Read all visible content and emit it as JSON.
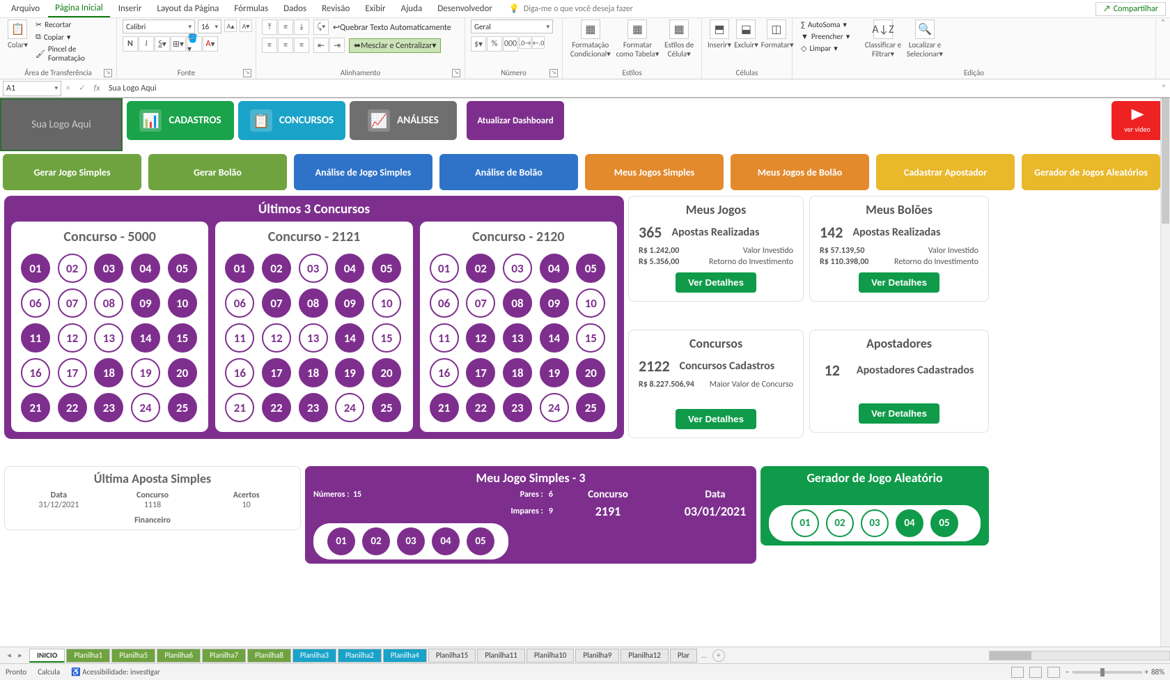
{
  "menu": {
    "items": [
      "Arquivo",
      "Página Inicial",
      "Inserir",
      "Layout da Página",
      "Fórmulas",
      "Dados",
      "Revisão",
      "Exibir",
      "Ajuda",
      "Desenvolvedor"
    ],
    "active": 1,
    "tellme": "Diga-me o que você deseja fazer",
    "share": "Compartilhar"
  },
  "ribbon": {
    "clipboard": {
      "paste": "Colar",
      "cut": "Recortar",
      "copy": "Copiar",
      "painter": "Pincel de Formatação",
      "label": "Área de Transferência"
    },
    "font": {
      "name": "Calibri",
      "size": "16",
      "label": "Fonte"
    },
    "align": {
      "wrap": "Quebrar Texto Automaticamente",
      "merge": "Mesclar e Centralizar",
      "label": "Alinhamento"
    },
    "number": {
      "format": "Geral",
      "label": "Número"
    },
    "styles": {
      "cond": "Formatação Condicional",
      "table": "Formatar como Tabela",
      "cell": "Estilos de Célula",
      "label": "Estilos"
    },
    "cells": {
      "insert": "Inserir",
      "delete": "Excluir",
      "format": "Formatar",
      "label": "Células"
    },
    "editing": {
      "sum": "AutoSoma",
      "fill": "Preencher",
      "clear": "Limpar",
      "sort": "Classificar e Filtrar",
      "find": "Localizar e Selecionar",
      "label": "Edição"
    }
  },
  "fbar": {
    "cell": "A1",
    "value": "Sua Logo Aqui"
  },
  "dash": {
    "logo": "Sua Logo Aqui",
    "nav": [
      {
        "l": "CADASTROS",
        "c": "#1aa34a"
      },
      {
        "l": "CONCURSOS",
        "c": "#1aa3c9"
      },
      {
        "l": "ANÁLISES",
        "c": "#6f6f6f"
      },
      {
        "l": "Atualizar Dashboard",
        "c": "#7e2f8e"
      }
    ],
    "video": "ver video",
    "row2": [
      "Gerar Jogo Simples",
      "Gerar Bolão",
      "Análise de Jogo Simples",
      "Análise de Bolão",
      "Meus Jogos Simples",
      "Meus Jogos de Bolão",
      "Cadastrar Apostador",
      "Gerador de Jogos Aleatórios"
    ],
    "row2c": [
      "green",
      "green",
      "blue2",
      "blue2",
      "orange",
      "orange",
      "gold",
      "gold"
    ],
    "last3": {
      "title": "Últimos 3  Concursos",
      "cards": [
        {
          "t": "Concurso - 5000",
          "b": [
            1,
            0,
            1,
            1,
            1,
            0,
            0,
            0,
            1,
            1,
            1,
            0,
            0,
            1,
            1,
            0,
            0,
            1,
            0,
            1,
            1,
            1,
            1,
            0,
            1
          ]
        },
        {
          "t": "Concurso - 2121",
          "b": [
            1,
            1,
            0,
            1,
            1,
            0,
            1,
            1,
            1,
            0,
            0,
            0,
            0,
            1,
            0,
            0,
            1,
            1,
            1,
            1,
            0,
            1,
            1,
            0,
            1
          ]
        },
        {
          "t": "Concurso - 2120",
          "b": [
            0,
            1,
            0,
            1,
            1,
            0,
            0,
            1,
            1,
            0,
            0,
            1,
            1,
            1,
            0,
            0,
            1,
            1,
            1,
            1,
            1,
            1,
            1,
            0,
            1
          ]
        }
      ]
    },
    "stats": {
      "jogos": {
        "t": "Meus Jogos",
        "n": "365",
        "nl": "Apostas Realizadas",
        "l1a": "R$ 1.242,00",
        "l1b": "Valor Investido",
        "l2a": "R$ 5.356,00",
        "l2b": "Retorno do Investimento",
        "btn": "Ver Detalhes"
      },
      "boloes": {
        "t": "Meus Bolões",
        "n": "142",
        "nl": "Apostas Realizadas",
        "l1a": "R$ 57.139,50",
        "l1b": "Valor Investido",
        "l2a": "R$ 110.398,00",
        "l2b": "Retorno do Investimento",
        "btn": "Ver Detalhes"
      },
      "conc": {
        "t": "Concursos",
        "n": "2122",
        "nl": "Concursos Cadastros",
        "l1a": "R$ 8.227.506,94",
        "l1b": "Maior Valor de Concurso",
        "btn": "Ver Detalhes"
      },
      "apost": {
        "t": "Apostadores",
        "n": "12",
        "nl": "Apostadores Cadastrados",
        "btn": "Ver Detalhes"
      }
    },
    "lastbet": {
      "t": "Última Aposta Simples",
      "h": [
        "Data",
        "Concurso",
        "Acertos"
      ],
      "d": [
        "31/12/2021",
        "1118",
        "10"
      ],
      "fin": "Financeiro"
    },
    "mjs": {
      "t": "Meu Jogo Simples - 3",
      "num_l": "Números :",
      "num_v": "15",
      "par_l": "Pares :",
      "par_v": "6",
      "imp_l": "Impares :",
      "imp_v": "9",
      "conc_l": "Concurso",
      "conc_v": "2191",
      "data_l": "Data",
      "data_v": "03/01/2021",
      "balls": [
        "01",
        "02",
        "03",
        "04",
        "05"
      ]
    },
    "gen": {
      "t": "Gerador de Jogo Aleatório",
      "balls": [
        {
          "n": "01",
          "f": 0
        },
        {
          "n": "02",
          "f": 0
        },
        {
          "n": "03",
          "f": 0
        },
        {
          "n": "04",
          "f": 1
        },
        {
          "n": "05",
          "f": 1
        }
      ]
    }
  },
  "tabs": {
    "items": [
      {
        "l": "INICIO",
        "cls": "active"
      },
      {
        "l": "Planilha1",
        "cls": "g"
      },
      {
        "l": "Planilha5",
        "cls": "g"
      },
      {
        "l": "Planilha6",
        "cls": "g"
      },
      {
        "l": "Planilha7",
        "cls": "g"
      },
      {
        "l": "Planilha8",
        "cls": "g"
      },
      {
        "l": "Planilha3",
        "cls": "b"
      },
      {
        "l": "Planilha2",
        "cls": "b"
      },
      {
        "l": "Planilha4",
        "cls": "b"
      },
      {
        "l": "Planilha15",
        "cls": ""
      },
      {
        "l": "Planilha11",
        "cls": ""
      },
      {
        "l": "Planilha10",
        "cls": ""
      },
      {
        "l": "Planilha9",
        "cls": ""
      },
      {
        "l": "Planilha12",
        "cls": ""
      },
      {
        "l": "Plar",
        "cls": ""
      }
    ]
  },
  "status": {
    "ready": "Pronto",
    "calc": "Calcula",
    "acc": "Acessibilidade: investigar",
    "zoom": "88%"
  }
}
